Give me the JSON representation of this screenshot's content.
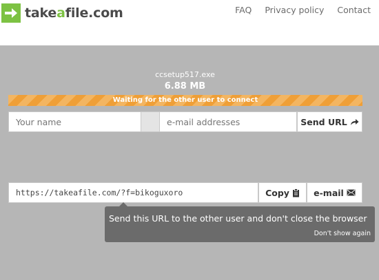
{
  "header": {
    "logo": {
      "pre": "take",
      "accent": "a",
      "post": "file.com",
      "icon": "arrow-right-icon",
      "accent_color": "#7dc243"
    },
    "nav": [
      {
        "label": "FAQ"
      },
      {
        "label": "Privacy policy"
      },
      {
        "label": "Contact"
      }
    ]
  },
  "transfer": {
    "file_name": "ccsetup517.exe",
    "file_size": "6.88 MB",
    "progress": 0,
    "status": "Waiting for the other user to connect",
    "status_color": "#ef9f37"
  },
  "share_form": {
    "name_placeholder": "Your name",
    "email_placeholder": "e-mail addresses",
    "send_url_label": "Send URL",
    "send_url_icon": "share-arrow-icon"
  },
  "link_row": {
    "url": "https://takeafile.com/?f=bikoguxoro",
    "copy_label": "Copy",
    "copy_icon": "clipboard-icon",
    "email_label": "e-mail",
    "email_icon": "envelope-icon"
  },
  "tooltip": {
    "message": "Send this URL to the other user and don't close the browser",
    "dismiss_label": "Don't show again"
  }
}
